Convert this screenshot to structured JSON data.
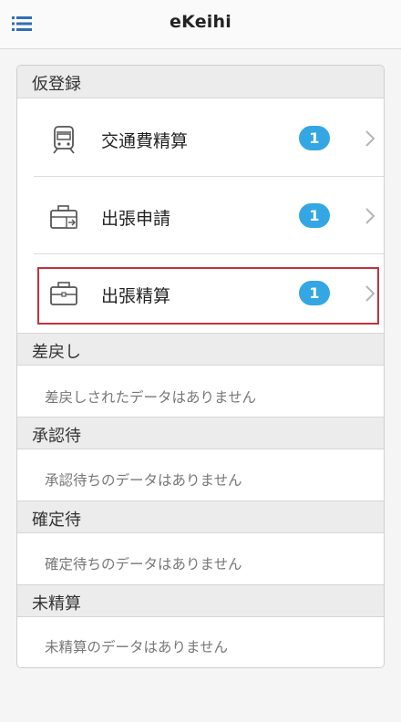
{
  "header": {
    "title": "eKeihi",
    "menu_icon": "list-menu-icon"
  },
  "colors": {
    "badge": "#34a6e4",
    "highlight_border": "#c0323b",
    "section_bg": "#ececec"
  },
  "sections": {
    "provisional": {
      "title": "仮登録",
      "items": [
        {
          "label": "交通費精算",
          "count": "1",
          "icon": "train-icon"
        },
        {
          "label": "出張申請",
          "count": "1",
          "icon": "briefcase-arrow-icon"
        },
        {
          "label": "出張精算",
          "count": "1",
          "icon": "briefcase-icon"
        }
      ]
    },
    "returned": {
      "title": "差戻し",
      "empty": "差戻しされたデータはありません"
    },
    "pending_approval": {
      "title": "承認待",
      "empty": "承認待ちのデータはありません"
    },
    "pending_confirm": {
      "title": "確定待",
      "empty": "確定待ちのデータはありません"
    },
    "unsettled": {
      "title": "未精算",
      "empty": "未精算のデータはありません"
    }
  }
}
